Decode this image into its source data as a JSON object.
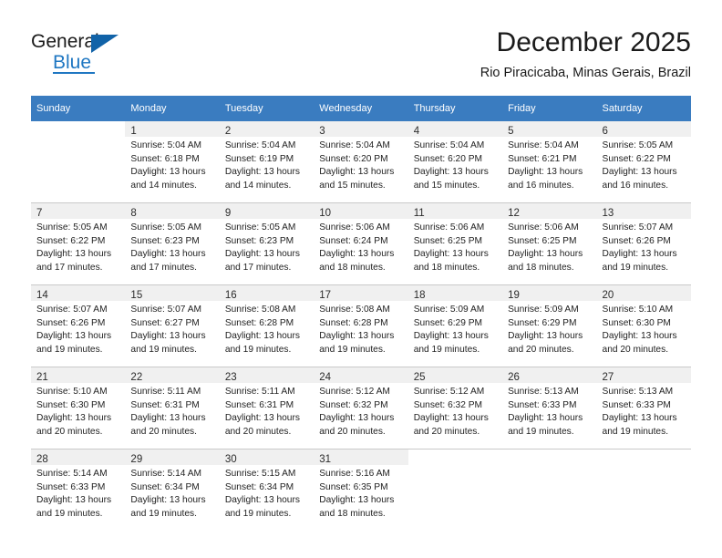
{
  "brand": {
    "name_part1": "General",
    "name_part2": "Blue",
    "logo_icon": "triangle-logo-icon"
  },
  "header": {
    "title": "December 2025",
    "subtitle": "Rio Piracicaba, Minas Gerais, Brazil"
  },
  "theme": {
    "header_row_bg": "#3a7cc0",
    "daynum_bg": "#f0f0f0",
    "brand_blue": "#1f77c2",
    "logo_blue": "#1163a8",
    "text": "#222222",
    "grid_line": "#c9c9c9"
  },
  "calendar": {
    "weekday_headers": [
      "Sunday",
      "Monday",
      "Tuesday",
      "Wednesday",
      "Thursday",
      "Friday",
      "Saturday"
    ],
    "weeks": [
      [
        {
          "day": "",
          "lines": []
        },
        {
          "day": "1",
          "lines": [
            "Sunrise: 5:04 AM",
            "Sunset: 6:18 PM",
            "Daylight: 13 hours",
            "and 14 minutes."
          ]
        },
        {
          "day": "2",
          "lines": [
            "Sunrise: 5:04 AM",
            "Sunset: 6:19 PM",
            "Daylight: 13 hours",
            "and 14 minutes."
          ]
        },
        {
          "day": "3",
          "lines": [
            "Sunrise: 5:04 AM",
            "Sunset: 6:20 PM",
            "Daylight: 13 hours",
            "and 15 minutes."
          ]
        },
        {
          "day": "4",
          "lines": [
            "Sunrise: 5:04 AM",
            "Sunset: 6:20 PM",
            "Daylight: 13 hours",
            "and 15 minutes."
          ]
        },
        {
          "day": "5",
          "lines": [
            "Sunrise: 5:04 AM",
            "Sunset: 6:21 PM",
            "Daylight: 13 hours",
            "and 16 minutes."
          ]
        },
        {
          "day": "6",
          "lines": [
            "Sunrise: 5:05 AM",
            "Sunset: 6:22 PM",
            "Daylight: 13 hours",
            "and 16 minutes."
          ]
        }
      ],
      [
        {
          "day": "7",
          "lines": [
            "Sunrise: 5:05 AM",
            "Sunset: 6:22 PM",
            "Daylight: 13 hours",
            "and 17 minutes."
          ]
        },
        {
          "day": "8",
          "lines": [
            "Sunrise: 5:05 AM",
            "Sunset: 6:23 PM",
            "Daylight: 13 hours",
            "and 17 minutes."
          ]
        },
        {
          "day": "9",
          "lines": [
            "Sunrise: 5:05 AM",
            "Sunset: 6:23 PM",
            "Daylight: 13 hours",
            "and 17 minutes."
          ]
        },
        {
          "day": "10",
          "lines": [
            "Sunrise: 5:06 AM",
            "Sunset: 6:24 PM",
            "Daylight: 13 hours",
            "and 18 minutes."
          ]
        },
        {
          "day": "11",
          "lines": [
            "Sunrise: 5:06 AM",
            "Sunset: 6:25 PM",
            "Daylight: 13 hours",
            "and 18 minutes."
          ]
        },
        {
          "day": "12",
          "lines": [
            "Sunrise: 5:06 AM",
            "Sunset: 6:25 PM",
            "Daylight: 13 hours",
            "and 18 minutes."
          ]
        },
        {
          "day": "13",
          "lines": [
            "Sunrise: 5:07 AM",
            "Sunset: 6:26 PM",
            "Daylight: 13 hours",
            "and 19 minutes."
          ]
        }
      ],
      [
        {
          "day": "14",
          "lines": [
            "Sunrise: 5:07 AM",
            "Sunset: 6:26 PM",
            "Daylight: 13 hours",
            "and 19 minutes."
          ]
        },
        {
          "day": "15",
          "lines": [
            "Sunrise: 5:07 AM",
            "Sunset: 6:27 PM",
            "Daylight: 13 hours",
            "and 19 minutes."
          ]
        },
        {
          "day": "16",
          "lines": [
            "Sunrise: 5:08 AM",
            "Sunset: 6:28 PM",
            "Daylight: 13 hours",
            "and 19 minutes."
          ]
        },
        {
          "day": "17",
          "lines": [
            "Sunrise: 5:08 AM",
            "Sunset: 6:28 PM",
            "Daylight: 13 hours",
            "and 19 minutes."
          ]
        },
        {
          "day": "18",
          "lines": [
            "Sunrise: 5:09 AM",
            "Sunset: 6:29 PM",
            "Daylight: 13 hours",
            "and 19 minutes."
          ]
        },
        {
          "day": "19",
          "lines": [
            "Sunrise: 5:09 AM",
            "Sunset: 6:29 PM",
            "Daylight: 13 hours",
            "and 20 minutes."
          ]
        },
        {
          "day": "20",
          "lines": [
            "Sunrise: 5:10 AM",
            "Sunset: 6:30 PM",
            "Daylight: 13 hours",
            "and 20 minutes."
          ]
        }
      ],
      [
        {
          "day": "21",
          "lines": [
            "Sunrise: 5:10 AM",
            "Sunset: 6:30 PM",
            "Daylight: 13 hours",
            "and 20 minutes."
          ]
        },
        {
          "day": "22",
          "lines": [
            "Sunrise: 5:11 AM",
            "Sunset: 6:31 PM",
            "Daylight: 13 hours",
            "and 20 minutes."
          ]
        },
        {
          "day": "23",
          "lines": [
            "Sunrise: 5:11 AM",
            "Sunset: 6:31 PM",
            "Daylight: 13 hours",
            "and 20 minutes."
          ]
        },
        {
          "day": "24",
          "lines": [
            "Sunrise: 5:12 AM",
            "Sunset: 6:32 PM",
            "Daylight: 13 hours",
            "and 20 minutes."
          ]
        },
        {
          "day": "25",
          "lines": [
            "Sunrise: 5:12 AM",
            "Sunset: 6:32 PM",
            "Daylight: 13 hours",
            "and 20 minutes."
          ]
        },
        {
          "day": "26",
          "lines": [
            "Sunrise: 5:13 AM",
            "Sunset: 6:33 PM",
            "Daylight: 13 hours",
            "and 19 minutes."
          ]
        },
        {
          "day": "27",
          "lines": [
            "Sunrise: 5:13 AM",
            "Sunset: 6:33 PM",
            "Daylight: 13 hours",
            "and 19 minutes."
          ]
        }
      ],
      [
        {
          "day": "28",
          "lines": [
            "Sunrise: 5:14 AM",
            "Sunset: 6:33 PM",
            "Daylight: 13 hours",
            "and 19 minutes."
          ]
        },
        {
          "day": "29",
          "lines": [
            "Sunrise: 5:14 AM",
            "Sunset: 6:34 PM",
            "Daylight: 13 hours",
            "and 19 minutes."
          ]
        },
        {
          "day": "30",
          "lines": [
            "Sunrise: 5:15 AM",
            "Sunset: 6:34 PM",
            "Daylight: 13 hours",
            "and 19 minutes."
          ]
        },
        {
          "day": "31",
          "lines": [
            "Sunrise: 5:16 AM",
            "Sunset: 6:35 PM",
            "Daylight: 13 hours",
            "and 18 minutes."
          ]
        },
        {
          "day": "",
          "lines": []
        },
        {
          "day": "",
          "lines": []
        },
        {
          "day": "",
          "lines": []
        }
      ]
    ]
  }
}
